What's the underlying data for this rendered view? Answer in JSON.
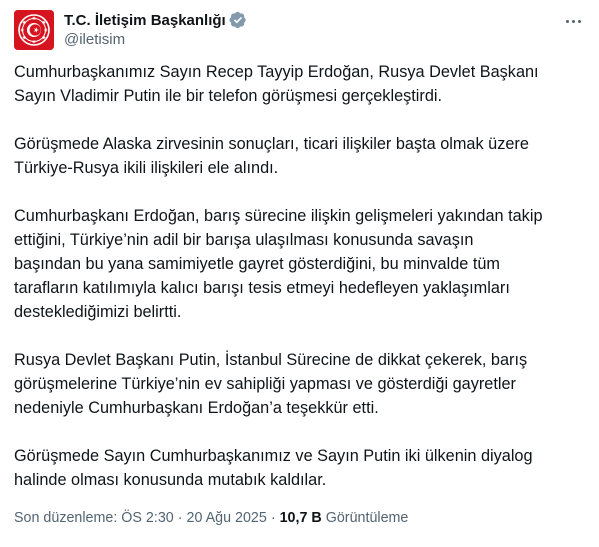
{
  "author": {
    "display_name": "T.C. İletişim Başkanlığı",
    "handle": "@iletisim",
    "verified_icon": "verified-badge-gray",
    "avatar_icon": "turkish-presidential-seal"
  },
  "tweet": {
    "paragraphs": [
      "Cumhurbaşkanımız Sayın Recep Tayyip Erdoğan, Rusya Devlet Başkanı\nSayın Vladimir Putin ile bir telefon görüşmesi gerçekleştirdi.",
      "Görüşmede Alaska zirvesinin sonuçları, ticari ilişkiler başta olmak üzere\nTürkiye-Rusya ikili ilişkileri ele alındı.",
      "Cumhurbaşkanı Erdoğan, barış sürecine ilişkin gelişmeleri yakından takip\nettiğini, Türkiye’nin adil bir barışa ulaşılması konusunda savaşın\nbaşından bu yana samimiyetle gayret gösterdiğini, bu minvalde tüm\ntarafların katılımıyla kalıcı barışı tesis etmeyi hedefleyen yaklaşımları\ndesteklediğimizi belirtti.",
      "Rusya Devlet Başkanı Putin, İstanbul Sürecine de dikkat çekerek, barış\ngörüşmelerine Türkiye’nin ev sahipliği yapması ve gösterdiği gayretler\nnedeniyle Cumhurbaşkanı Erdoğan’a teşekkür etti.",
      "Görüşmede Sayın Cumhurbaşkanımız ve Sayın Putin iki ülkenin diyalog\nhalinde olması konusunda mutabık kaldılar."
    ]
  },
  "meta": {
    "edited_label": "Son düzenleme: ÖS 2:30",
    "separator": "·",
    "date": "20 Ağu 2025",
    "views_count": "10,7 B",
    "views_label": "Görüntüleme"
  },
  "colors": {
    "avatar_red": "#d6141f",
    "text_primary": "#0f1419",
    "text_secondary": "#536471",
    "verified_gray": "#829aab"
  },
  "more_icon": "more-horizontal-icon"
}
